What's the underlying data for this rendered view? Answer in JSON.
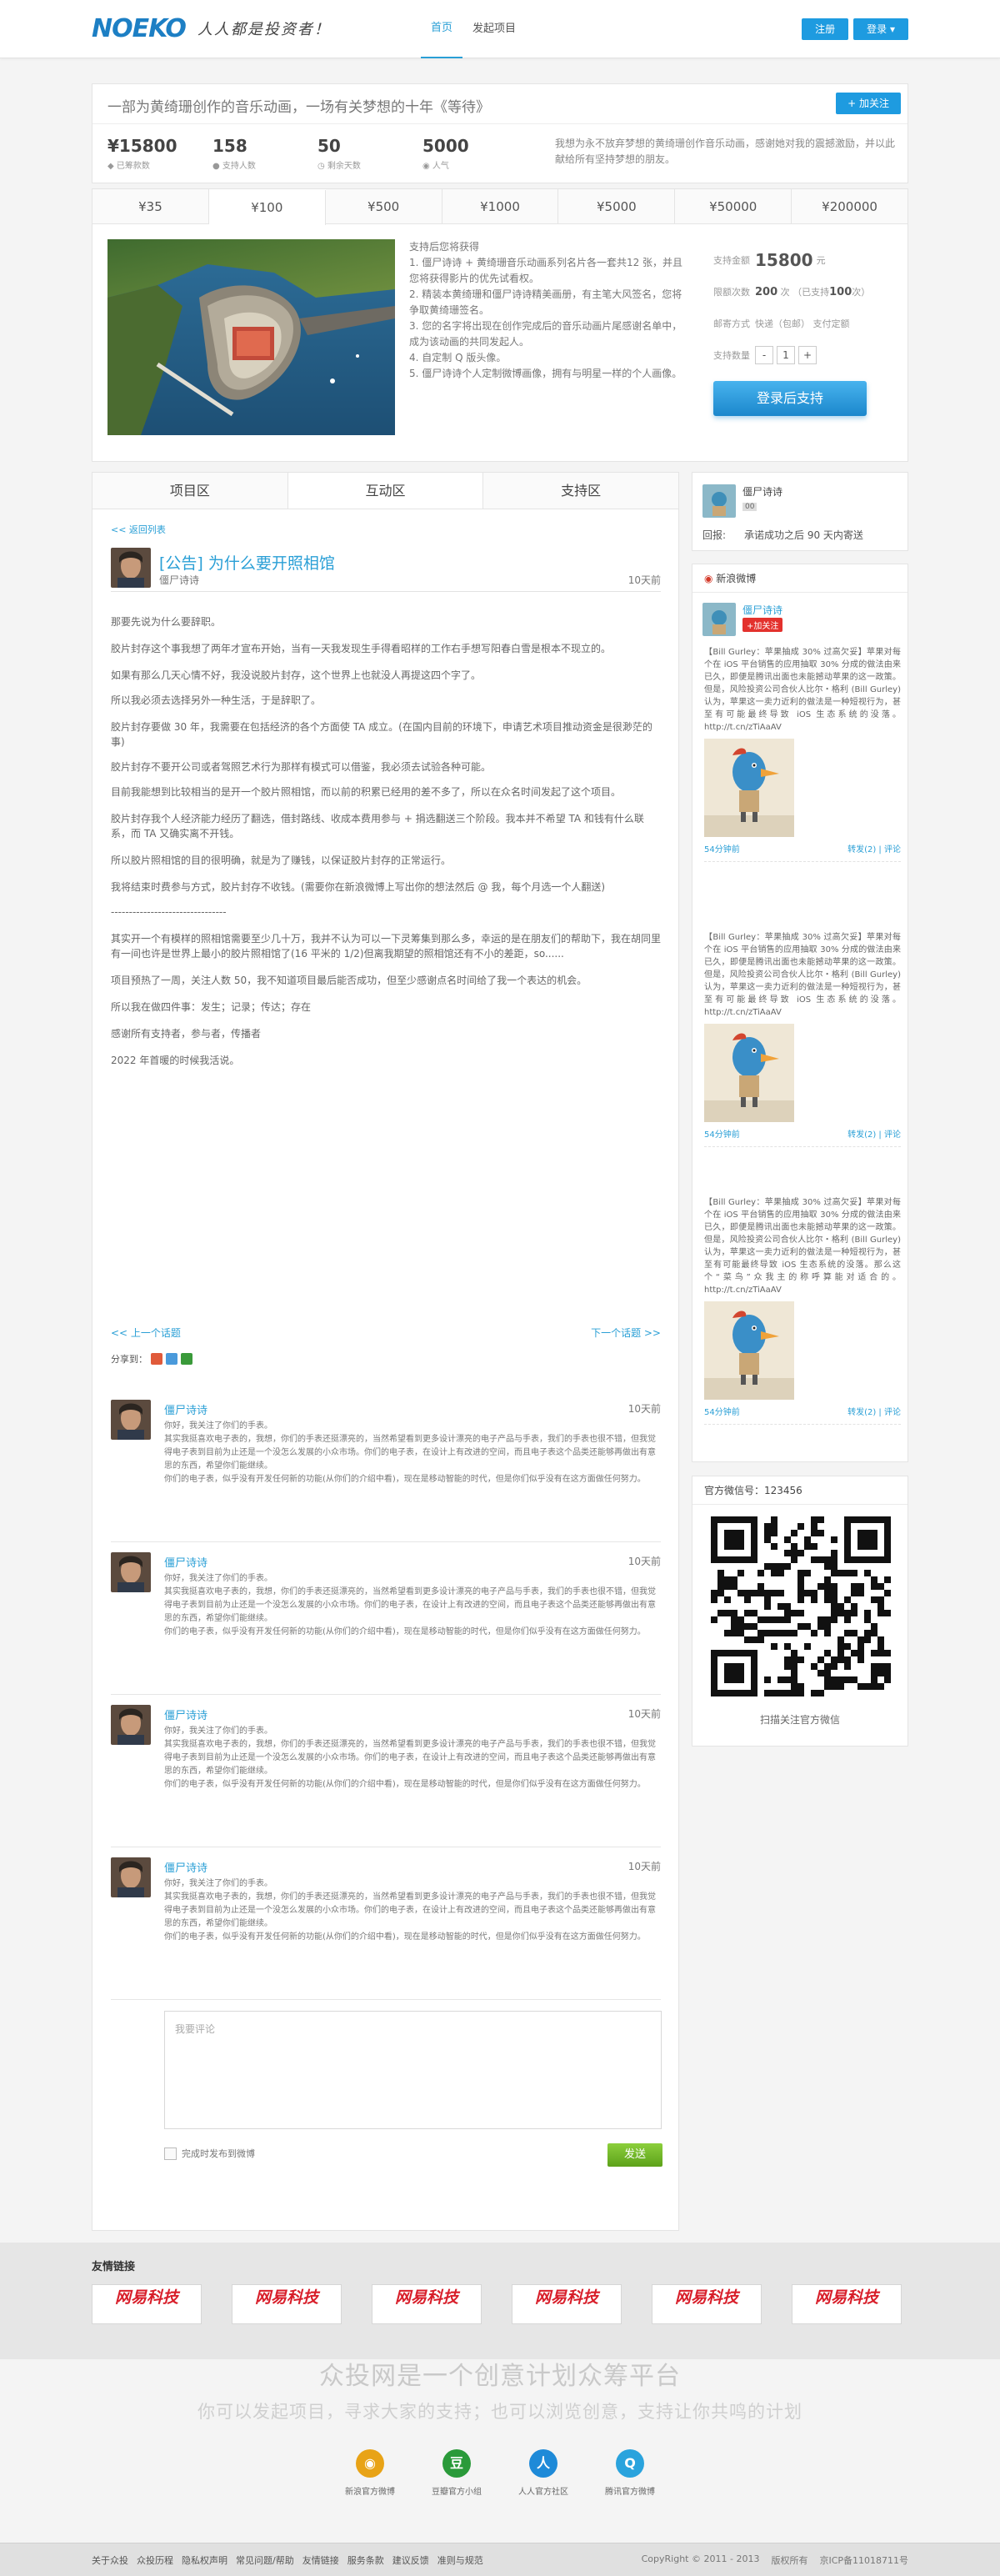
{
  "header": {
    "logo": "NOEKO",
    "slogan": "人人都是投资者！",
    "nav": [
      "首页",
      "发起项目"
    ],
    "register": "注册",
    "login": "登录 ▾"
  },
  "project": {
    "title": "一部为黄绮珊创作的音乐动画，一场有关梦想的十年《等待》",
    "follow": "+ 加关注",
    "stats": [
      {
        "value": "¥15800",
        "label": "已筹款数"
      },
      {
        "value": "158",
        "label": "支持人数"
      },
      {
        "value": "50",
        "label": "剩余天数"
      },
      {
        "value": "5000",
        "label": "人气"
      }
    ],
    "desc": "我想为永不放弃梦想的黄绮珊创作音乐动画，感谢她对我的震撼激励，并以此献给所有坚持梦想的朋友。"
  },
  "reward": {
    "tabs": [
      "¥35",
      "¥100",
      "¥500",
      "¥1000",
      "¥5000",
      "¥50000",
      "¥200000"
    ],
    "active_tab": 1,
    "intro": "支持后您将获得",
    "items": [
      "1. 僵尸诗诗 + 黄绮珊音乐动画系列名片各一套共12 张，并且您将获得影片的优先试看权。",
      "2. 精装本黄绮珊和僵尸诗诗精美画册，有主笔大风签名，您将争取黄绮珊签名。",
      "3. 您的名字将出现在创作完成后的音乐动画片尾感谢名单中，成为该动画的共同发起人。",
      "4. 自定制 Q 版头像。",
      "5. 僵尸诗诗个人定制微博画像，拥有与明星一样的个人画像。"
    ],
    "form": {
      "amount_label": "支持金额",
      "amount": "15800",
      "amount_unit": "元",
      "quota_label": "限额次数",
      "quota": "200",
      "quota_unit": "次",
      "quota_used_pre": "（已支持",
      "quota_used": "100",
      "quota_used_post": "次）",
      "ship_label": "邮寄方式",
      "ship": "快递（包邮） 支付定额",
      "count_label": "支持数量",
      "count": "1",
      "minus": "-",
      "plus": "+",
      "button": "登录后支持"
    }
  },
  "tabs": [
    "项目区",
    "互动区",
    "支持区"
  ],
  "active_main_tab": 1,
  "post": {
    "back": "<< 返回列表",
    "title": "[公告] 为什么要开照相馆",
    "author": "僵尸诗诗",
    "time": "10天前",
    "paragraphs": [
      "那要先说为什么要辞职。",
      "",
      "胶片封存这个事我想了两年才宣布开始，当有一天我发现生手得看昭样的工作右手想写阳春白雪是根本不现立的。",
      "",
      "如果有那么几天心情不好，我没说胶片封存，这个世界上也就没人再提这四个字了。",
      "所以我必须去选择另外一种生活，于是辞职了。",
      "",
      "胶片封存要做 30 年，我需要在包括经济的各个方面使 TA 成立。(在国内目前的环境下，申请艺术项目推动资金是很渺茫的事)",
      "胶片封存不要开公司或者驾照艺术行为那样有模式可以借鉴，我必须去试验各种可能。",
      "目前我能想到比较相当的是开一个胶片照相馆，而以前的积累已经用的差不多了，所以在众名时间发起了这个项目。",
      "",
      "胶片封存我个人经济能力经历了翻选，借封路线、收成本费用参与 + 捐选翻送三个阶段。我本并不希望 TA 和钱有什么联系，而 TA 又确实离不开钱。",
      "",
      "所以胶片照相馆的目的很明确，就是为了赚钱，以保证胶片封存的正常运行。",
      "",
      "我将结束时费参与方式，胶片封存不收钱。(需要你在新浪微博上写出你的想法然后 @ 我，每个月选一个人翻送)",
      "--------------------------------",
      "",
      "其实开一个有模样的照相馆需要至少几十万，我并不认为可以一下灵筹集到那么多，幸运的是在朋友们的帮助下，我在胡同里有一间也许是世界上最小的胶片照相馆了(16 平米的 1/2)但离我期望的照相馆还有不小的差距，so......",
      "",
      "项目预热了一周，关注人数 50，我不知道项目最后能否成功，但至少感谢点名时间给了我一个表达的机会。",
      "",
      "所以我在做四件事：发生；记录；传达；存在",
      "",
      "感谢所有支持者，参与者，传播者",
      "",
      "2022 年首暖的时候我活说。"
    ],
    "prev": "<< 上一个话题",
    "next": "下一个话题 >>",
    "share": "分享到："
  },
  "comments": [
    {
      "name": "僵尸诗诗",
      "time": "10天前",
      "text": "你好，我关注了你们的手表。\n其实我挺喜欢电子表的，我想，你们的手表还挺漂亮的，当然希望看到更多设计漂亮的电子产品与手表，我们的手表也很不错，但我觉得电子表到目前为止还是一个没怎么发展的小众市场。你们的电子表，在设计上有改进的空间，而且电子表这个品类还能够再做出有意思的东西，希望你们能继续。\n你们的电子表，似乎没有开发任何新的功能(从你们的介绍中看)，现在是移动智能的时代，但是你们似乎没有在这方面做任何努力。"
    },
    {
      "name": "僵尸诗诗",
      "time": "10天前",
      "text": "你好，我关注了你们的手表。\n其实我挺喜欢电子表的，我想，你们的手表还挺漂亮的，当然希望看到更多设计漂亮的电子产品与手表，我们的手表也很不错，但我觉得电子表到目前为止还是一个没怎么发展的小众市场。你们的电子表，在设计上有改进的空间，而且电子表这个品类还能够再做出有意思的东西，希望你们能继续。\n你们的电子表，似乎没有开发任何新的功能(从你们的介绍中看)，现在是移动智能的时代，但是你们似乎没有在这方面做任何努力。"
    },
    {
      "name": "僵尸诗诗",
      "time": "10天前",
      "text": "你好，我关注了你们的手表。\n其实我挺喜欢电子表的，我想，你们的手表还挺漂亮的，当然希望看到更多设计漂亮的电子产品与手表，我们的手表也很不错，但我觉得电子表到目前为止还是一个没怎么发展的小众市场。你们的电子表，在设计上有改进的空间，而且电子表这个品类还能够再做出有意思的东西，希望你们能继续。\n你们的电子表，似乎没有开发任何新的功能(从你们的介绍中看)，现在是移动智能的时代，但是你们似乎没有在这方面做任何努力。"
    },
    {
      "name": "僵尸诗诗",
      "time": "10天前",
      "text": "你好，我关注了你们的手表。\n其实我挺喜欢电子表的，我想，你们的手表还挺漂亮的，当然希望看到更多设计漂亮的电子产品与手表，我们的手表也很不错，但我觉得电子表到目前为止还是一个没怎么发展的小众市场。你们的电子表，在设计上有改进的空间，而且电子表这个品类还能够再做出有意思的东西，希望你们能继续。\n你们的电子表，似乎没有开发任何新的功能(从你们的介绍中看)，现在是移动智能的时代，但是你们似乎没有在这方面做任何努力。"
    }
  ],
  "reply": {
    "placeholder": "我要评论",
    "sync": "完成时发布到微博",
    "send": "发送"
  },
  "sidebar": {
    "owner_name": "僵尸诗诗",
    "owner_badge": "00",
    "goal_label": "回报:",
    "goal": "承诺成功之后 90 天内寄送",
    "weibo_title": "新浪微博",
    "weibo_user": "僵尸诗诗",
    "weibo_follow": "+加关注",
    "weibo_posts": [
      {
        "text": "【Bill Gurley：苹果抽成 30% 过高欠妥】苹果对每个在 iOS 平台销售的应用抽取 30% 分成的做法由来已久，即便是腾讯出面也未能撼动苹果的这一政策。但是，风险投资公司合伙人比尔・格利 (Bill Gurley) 认为，苹果这一卖力近利的做法是一种短视行为，甚至有可能最终导致 iOS 生态系统的没落。http://t.cn/zTiAaAV",
        "time": "54分钟前",
        "actions": "转发(2)  |  评论"
      },
      {
        "text": "【Bill Gurley：苹果抽成 30% 过高欠妥】苹果对每个在 iOS 平台销售的应用抽取 30% 分成的做法由来已久，即便是腾讯出面也未能撼动苹果的这一政策。但是，风险投资公司合伙人比尔・格利 (Bill Gurley) 认为，苹果这一卖力近利的做法是一种短视行为，甚至有可能最终导致 iOS 生态系统的没落。http://t.cn/zTiAaAV",
        "time": "54分钟前",
        "actions": "转发(2)  |  评论"
      },
      {
        "text": "【Bill Gurley：苹果抽成 30% 过高欠妥】苹果对每个在 iOS 平台销售的应用抽取 30% 分成的做法由来已久，即便是腾讯出面也未能撼动苹果的这一政策。但是，风险投资公司合伙人比尔・格利 (Bill Gurley) 认为，苹果这一卖力近利的做法是一种短视行为，甚至有可能最终导致 iOS 生态系统的没落。那么这个“菜鸟”众我主的称呼算能对适合的。http://t.cn/zTiAaAV",
        "time": "54分钟前",
        "actions": "转发(2)  |  评论"
      }
    ],
    "wechat_title": "官方微信号：123456",
    "wechat_caption": "扫描关注官方微信"
  },
  "footer": {
    "links_title": "友情链接",
    "partner_logos": [
      "网易科技",
      "网易科技",
      "网易科技",
      "网易科技",
      "网易科技",
      "网易科技"
    ],
    "slogan": "众投网是一个创意计划众筹平台",
    "subslogan": "你可以发起项目，寻求大家的支持；也可以浏览创意，支持让你共鸣的计划",
    "social": [
      {
        "label": "新浪官方微博",
        "color": "#e8a317",
        "glyph": "◉"
      },
      {
        "label": "豆瓣官方小组",
        "color": "#2a9a3a",
        "glyph": "豆"
      },
      {
        "label": "人人官方社区",
        "color": "#1e8ad8",
        "glyph": "人"
      },
      {
        "label": "腾讯官方微博",
        "color": "#2aa3dd",
        "glyph": "Q"
      }
    ],
    "bottom_links": [
      "关于众投",
      "众投历程",
      "隐私权声明",
      "常见问题/帮助",
      "友情链接",
      "服务条款",
      "建议反馈",
      "准则与规范"
    ],
    "copyright": "CopyRight © 2011 - 2013",
    "rights": "版权所有",
    "icp": "京ICP备11018711号"
  }
}
